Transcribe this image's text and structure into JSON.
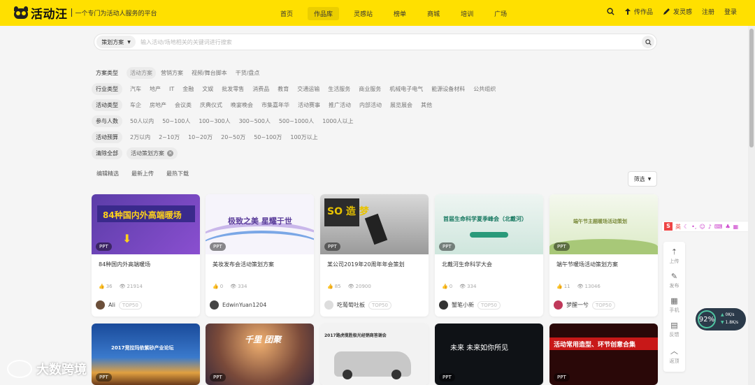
{
  "brand": {
    "name": "活动汪",
    "tagline": "一个专门为活动人服务的平台"
  },
  "nav": [
    {
      "label": "首页",
      "active": false
    },
    {
      "label": "作品库",
      "active": true
    },
    {
      "label": "灵感站",
      "active": false
    },
    {
      "label": "榜单",
      "active": false
    },
    {
      "label": "商城",
      "active": false
    },
    {
      "label": "培训",
      "active": false
    },
    {
      "label": "广场",
      "active": false
    }
  ],
  "top_right": {
    "upload": "传作品",
    "post": "发灵感",
    "register": "注册",
    "login": "登录"
  },
  "search": {
    "category": "策划方案",
    "placeholder": "输入活动/场地相关的关键词进行搜索"
  },
  "filters": {
    "plan_type": {
      "label": "方案类型",
      "options": [
        "活动方案",
        "营销方案",
        "视频/舞台脚本",
        "干货/盘点"
      ],
      "selected": "活动方案"
    },
    "industry": {
      "label": "行业类型",
      "options": [
        "汽车",
        "地产",
        "IT",
        "金融",
        "文娱",
        "批发零售",
        "消费品",
        "教育",
        "交通运输",
        "生活服务",
        "商业服务",
        "机械电子电气",
        "能源设备材料",
        "公共组织"
      ]
    },
    "activity": {
      "label": "活动类型",
      "options": [
        "车企",
        "房地产",
        "会议类",
        "庆典仪式",
        "晚宴晚会",
        "市集嘉年华",
        "活动赛事",
        "推广活动",
        "内部活动",
        "展览展会",
        "其他"
      ]
    },
    "people": {
      "label": "参与人数",
      "options": [
        "50人以内",
        "50~100人",
        "100~300人",
        "300~500人",
        "500~1000人",
        "1000人以上"
      ]
    },
    "budget": {
      "label": "活动预算",
      "options": [
        "2万以内",
        "2~10万",
        "10~20万",
        "20~50万",
        "50~100万",
        "100万以上"
      ]
    },
    "clear": {
      "label": "清除全部",
      "chip": "活动策划方案"
    }
  },
  "sort": [
    "编辑精选",
    "最新上传",
    "最热下载"
  ],
  "filter_button": "筛选",
  "cards": [
    {
      "title": "84种国内外高端暖场",
      "thumb_text": "84种国内外高端暖场",
      "badge": "PPT",
      "likes": "36",
      "views": "21914",
      "author": "Ali",
      "rank": "TOP50"
    },
    {
      "title": "美妆发布会活动策划方案",
      "thumb_text": "极致之美 星耀于世",
      "badge": "PPT",
      "likes": "0",
      "views": "334",
      "author": "EdwinYuan1204",
      "rank": ""
    },
    {
      "title": "某公司2019年20周年年会策划",
      "thumb_text": "SO 造 梦",
      "badge": "PPT",
      "likes": "85",
      "views": "20900",
      "author": "吃葡萄吐板",
      "rank": "TOP50"
    },
    {
      "title": "北戴河生命科学大会",
      "thumb_text": "首届生命科学夏季峰会（北戴河）",
      "badge": "PPT",
      "likes": "0",
      "views": "334",
      "author": "蟹笔小新",
      "rank": "TOP50"
    },
    {
      "title": "端午节暖场活动策划方案",
      "thumb_text": "端午节主题暖场活动策划",
      "badge": "PPT",
      "likes": "11",
      "views": "13046",
      "author": "梦醒一兮",
      "rank": "TOP50"
    },
    {
      "title": "",
      "thumb_text": "2017竞拉玛依紫砂产业论坛",
      "badge": "PPT"
    },
    {
      "title": "",
      "thumb_text": "千里 团聚",
      "badge": "PPT"
    },
    {
      "title": "",
      "thumb_text": "2017路虎揽胜极光经销商答谢会",
      "badge": ""
    },
    {
      "title": "",
      "thumb_text": "未来 未来如你所见",
      "badge": "PPT"
    },
    {
      "title": "",
      "thumb_text": "活动常用造型、环节创意合集",
      "badge": "PPT"
    }
  ],
  "side_tools": [
    {
      "icon": "upload-icon",
      "label": "上传"
    },
    {
      "icon": "pen-icon",
      "label": "发布"
    },
    {
      "icon": "qr-icon",
      "label": "手机"
    },
    {
      "icon": "feedback-icon",
      "label": "反馈"
    },
    {
      "icon": "top-icon",
      "label": "返顶"
    }
  ],
  "speed": {
    "pct": "92%",
    "up": "0K/s",
    "down": "1.8K/s"
  },
  "ime": {
    "label": "英"
  },
  "watermark": "大数跨境"
}
